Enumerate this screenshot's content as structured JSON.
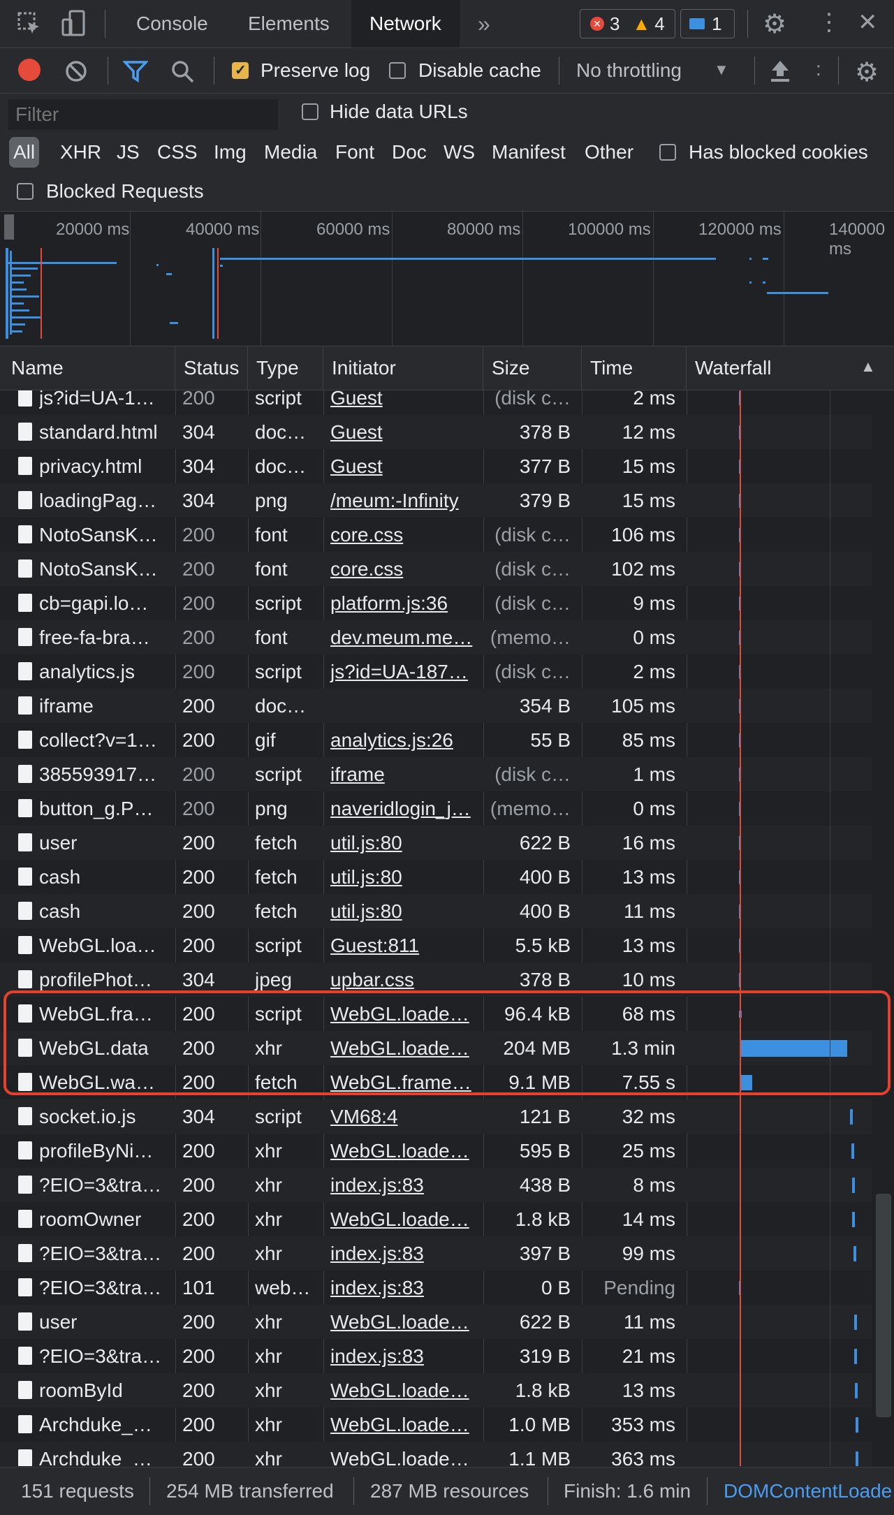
{
  "tabs": {
    "console": "Console",
    "elements": "Elements",
    "network": "Network"
  },
  "badges": {
    "errors": "3",
    "warnings": "4",
    "messages": "1"
  },
  "toolbar": {
    "preserve_log": "Preserve log",
    "disable_cache": "Disable cache",
    "throttling": "No throttling"
  },
  "filter": {
    "placeholder": "Filter",
    "hide_data_urls": "Hide data URLs",
    "types": [
      "All",
      "XHR",
      "JS",
      "CSS",
      "Img",
      "Media",
      "Font",
      "Doc",
      "WS",
      "Manifest",
      "Other"
    ],
    "has_blocked_cookies": "Has blocked cookies",
    "blocked_requests": "Blocked Requests"
  },
  "overview": {
    "ticks": [
      "20000 ms",
      "40000 ms",
      "60000 ms",
      "80000 ms",
      "100000 ms",
      "120000 ms",
      "140000 ms"
    ]
  },
  "columns": {
    "name": "Name",
    "status": "Status",
    "type": "Type",
    "initiator": "Initiator",
    "size": "Size",
    "time": "Time",
    "waterfall": "Waterfall"
  },
  "rows": [
    {
      "name": "js?id=UA-1…",
      "status": "200",
      "type": "script",
      "initiator": "Guest",
      "size": "(disk c…",
      "time": "2 ms"
    },
    {
      "name": "standard.html",
      "status": "304",
      "type": "doc…",
      "initiator": "Guest",
      "size": "378 B",
      "time": "12 ms"
    },
    {
      "name": "privacy.html",
      "status": "304",
      "type": "doc…",
      "initiator": "Guest",
      "size": "377 B",
      "time": "15 ms"
    },
    {
      "name": "loadingPag…",
      "status": "304",
      "type": "png",
      "initiator": "/meum:-Infinity",
      "size": "379 B",
      "time": "15 ms"
    },
    {
      "name": "NotoSansK…",
      "status": "200",
      "type": "font",
      "initiator": "core.css",
      "size": "(disk c…",
      "time": "106 ms"
    },
    {
      "name": "NotoSansK…",
      "status": "200",
      "type": "font",
      "initiator": "core.css",
      "size": "(disk c…",
      "time": "102 ms"
    },
    {
      "name": "cb=gapi.lo…",
      "status": "200",
      "type": "script",
      "initiator": "platform.js:36",
      "size": "(disk c…",
      "time": "9 ms"
    },
    {
      "name": "free-fa-bra…",
      "status": "200",
      "type": "font",
      "initiator": "dev.meum.me…",
      "size": "(memo…",
      "time": "0 ms"
    },
    {
      "name": "analytics.js",
      "status": "200",
      "type": "script",
      "initiator": "js?id=UA-187…",
      "size": "(disk c…",
      "time": "2 ms"
    },
    {
      "name": "iframe",
      "status": "200",
      "type": "doc…",
      "initiator": "",
      "size": "354 B",
      "time": "105 ms"
    },
    {
      "name": "collect?v=1…",
      "status": "200",
      "type": "gif",
      "initiator": "analytics.js:26",
      "size": "55 B",
      "time": "85 ms"
    },
    {
      "name": "385593917…",
      "status": "200",
      "type": "script",
      "initiator": "iframe",
      "size": "(disk c…",
      "time": "1 ms"
    },
    {
      "name": "button_g.P…",
      "status": "200",
      "type": "png",
      "initiator": "naveridlogin_j…",
      "size": "(memo…",
      "time": "0 ms"
    },
    {
      "name": "user",
      "status": "200",
      "type": "fetch",
      "initiator": "util.js:80",
      "size": "622 B",
      "time": "16 ms"
    },
    {
      "name": "cash",
      "status": "200",
      "type": "fetch",
      "initiator": "util.js:80",
      "size": "400 B",
      "time": "13 ms"
    },
    {
      "name": "cash",
      "status": "200",
      "type": "fetch",
      "initiator": "util.js:80",
      "size": "400 B",
      "time": "11 ms"
    },
    {
      "name": "WebGL.loa…",
      "status": "200",
      "type": "script",
      "initiator": "Guest:811",
      "size": "5.5 kB",
      "time": "13 ms"
    },
    {
      "name": "profilePhot…",
      "status": "304",
      "type": "jpeg",
      "initiator": "upbar.css",
      "size": "378 B",
      "time": "10 ms"
    },
    {
      "name": "WebGL.fra…",
      "status": "200",
      "type": "script",
      "initiator": "WebGL.loade…",
      "size": "96.4 kB",
      "time": "68 ms"
    },
    {
      "name": "WebGL.data",
      "status": "200",
      "type": "xhr",
      "initiator": "WebGL.loade…",
      "size": "204 MB",
      "time": "1.3 min"
    },
    {
      "name": "WebGL.wa…",
      "status": "200",
      "type": "fetch",
      "initiator": "WebGL.frame…",
      "size": "9.1 MB",
      "time": "7.55 s"
    },
    {
      "name": "socket.io.js",
      "status": "304",
      "type": "script",
      "initiator": "VM68:4",
      "size": "121 B",
      "time": "32 ms"
    },
    {
      "name": "profileByNi…",
      "status": "200",
      "type": "xhr",
      "initiator": "WebGL.loade…",
      "size": "595 B",
      "time": "25 ms"
    },
    {
      "name": "?EIO=3&tra…",
      "status": "200",
      "type": "xhr",
      "initiator": "index.js:83",
      "size": "438 B",
      "time": "8 ms"
    },
    {
      "name": "roomOwner",
      "status": "200",
      "type": "xhr",
      "initiator": "WebGL.loade…",
      "size": "1.8 kB",
      "time": "14 ms"
    },
    {
      "name": "?EIO=3&tra…",
      "status": "200",
      "type": "xhr",
      "initiator": "index.js:83",
      "size": "397 B",
      "time": "99 ms"
    },
    {
      "name": "?EIO=3&tra…",
      "status": "101",
      "type": "web…",
      "initiator": "index.js:83",
      "size": "0 B",
      "time": "Pending"
    },
    {
      "name": "user",
      "status": "200",
      "type": "xhr",
      "initiator": "WebGL.loade…",
      "size": "622 B",
      "time": "11 ms"
    },
    {
      "name": "?EIO=3&tra…",
      "status": "200",
      "type": "xhr",
      "initiator": "index.js:83",
      "size": "319 B",
      "time": "21 ms"
    },
    {
      "name": "roomById",
      "status": "200",
      "type": "xhr",
      "initiator": "WebGL.loade…",
      "size": "1.8 kB",
      "time": "13 ms"
    },
    {
      "name": "Archduke_…",
      "status": "200",
      "type": "xhr",
      "initiator": "WebGL.loade…",
      "size": "1.0 MB",
      "time": "353 ms"
    },
    {
      "name": "Archduke_…",
      "status": "200",
      "type": "xhr",
      "initiator": "WebGL.loade…",
      "size": "1.1 MB",
      "time": "363 ms"
    }
  ],
  "status_bar": {
    "requests": "151 requests",
    "transferred": "254 MB transferred",
    "resources": "287 MB resources",
    "finish": "Finish: 1.6 min",
    "dom_content_loaded": "DOMContentLoade"
  },
  "colors": {
    "accent_blue": "#3d8fe0",
    "highlight_red": "#e8412b",
    "record_red": "#e64a3b"
  }
}
